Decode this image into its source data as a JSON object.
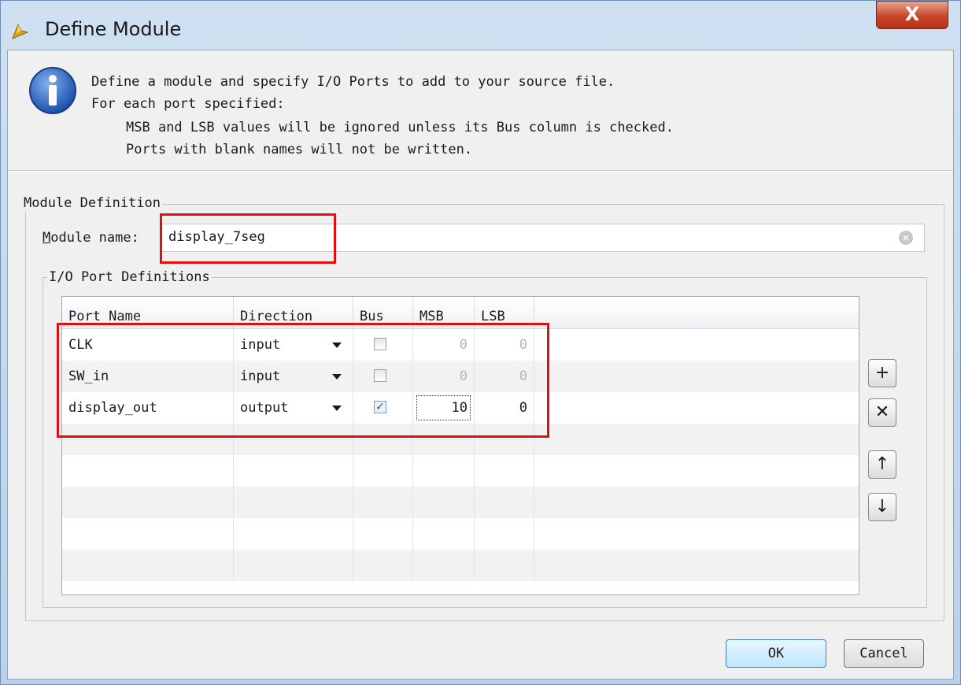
{
  "window": {
    "title": "Define Module",
    "close_label": "X"
  },
  "info": {
    "line1": "Define a module and specify I/O Ports to add to your source file.",
    "line2": "For each port specified:",
    "line3": "MSB and LSB values will be ignored unless its Bus column is checked.",
    "line4": "Ports with blank names will not be written."
  },
  "module_definition": {
    "group_label": "Module Definition",
    "name_label_mnemonic": "M",
    "name_label_rest": "odule name:",
    "name_value": "display_7seg"
  },
  "ports": {
    "group_label": "I/O Port Definitions",
    "columns": [
      "Port Name",
      "Direction",
      "Bus",
      "MSB",
      "LSB"
    ],
    "rows": [
      {
        "name": "CLK",
        "direction": "input",
        "bus": false,
        "msb": "0",
        "lsb": "0"
      },
      {
        "name": "SW_in",
        "direction": "input",
        "bus": false,
        "msb": "0",
        "lsb": "0"
      },
      {
        "name": "display_out",
        "direction": "output",
        "bus": true,
        "msb": "10",
        "lsb": "0"
      }
    ],
    "side_buttons": [
      {
        "name": "add-port-button",
        "icon": "plus-icon",
        "glyph": "+"
      },
      {
        "name": "remove-port-button",
        "icon": "x-icon",
        "glyph": "✕"
      },
      {
        "name": "move-up-button",
        "icon": "arrow-up-icon",
        "glyph": "↑"
      },
      {
        "name": "move-down-button",
        "icon": "arrow-down-icon",
        "glyph": "↓"
      }
    ]
  },
  "buttons": {
    "ok": "OK",
    "cancel": "Cancel"
  },
  "colors": {
    "highlight_box": "#e01010",
    "title_bar": "#cfe0f1",
    "close_button": "#c8452c"
  }
}
